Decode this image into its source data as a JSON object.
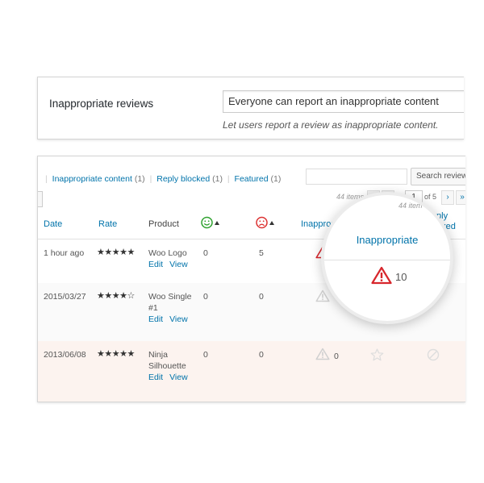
{
  "settings": {
    "label": "Inappropriate reviews",
    "field_value": "Everyone can report an inappropriate content",
    "description": "Let users report a review as inappropriate content."
  },
  "filters": [
    {
      "label": "Inappropriate content",
      "count": "(1)"
    },
    {
      "label": "Reply blocked",
      "count": "(1)"
    },
    {
      "label": "Featured",
      "count": "(1)"
    }
  ],
  "search": {
    "button_label": "Search reviews"
  },
  "pagination": {
    "items": "44 items",
    "current_page": "1",
    "of_pages": "of 5",
    "next": "›",
    "last": "»"
  },
  "columns": {
    "date": "Date",
    "rate": "Rate",
    "product": "Product",
    "inappropriate": "Inapprop",
    "reply_blocked": "Reply blocked"
  },
  "rows": [
    {
      "date": "1 hour ago",
      "rating": 5,
      "stars": "★★★★★",
      "product": "Woo Logo",
      "edit": "Edit",
      "view": "View",
      "positive": "0",
      "negative": "5",
      "inappropriate": ""
    },
    {
      "date": "2015/03/27",
      "rating": 4,
      "stars": "★★★★☆",
      "product": "Woo Single #1",
      "edit": "Edit",
      "view": "View",
      "positive": "0",
      "negative": "0",
      "inappropriate": ""
    },
    {
      "date": "2013/06/08",
      "rating": 5,
      "stars": "★★★★★",
      "product": "Ninja Silhouette",
      "edit": "Edit",
      "view": "View",
      "positive": "0",
      "negative": "0",
      "inappropriate": "0"
    }
  ],
  "magnifier": {
    "header": "Inappropriate",
    "count": "10",
    "faint_items": "44 item"
  },
  "colors": {
    "link": "#0073aa",
    "positive": "#2ea12e",
    "negative": "#dc3232",
    "alert": "#d7262c"
  }
}
